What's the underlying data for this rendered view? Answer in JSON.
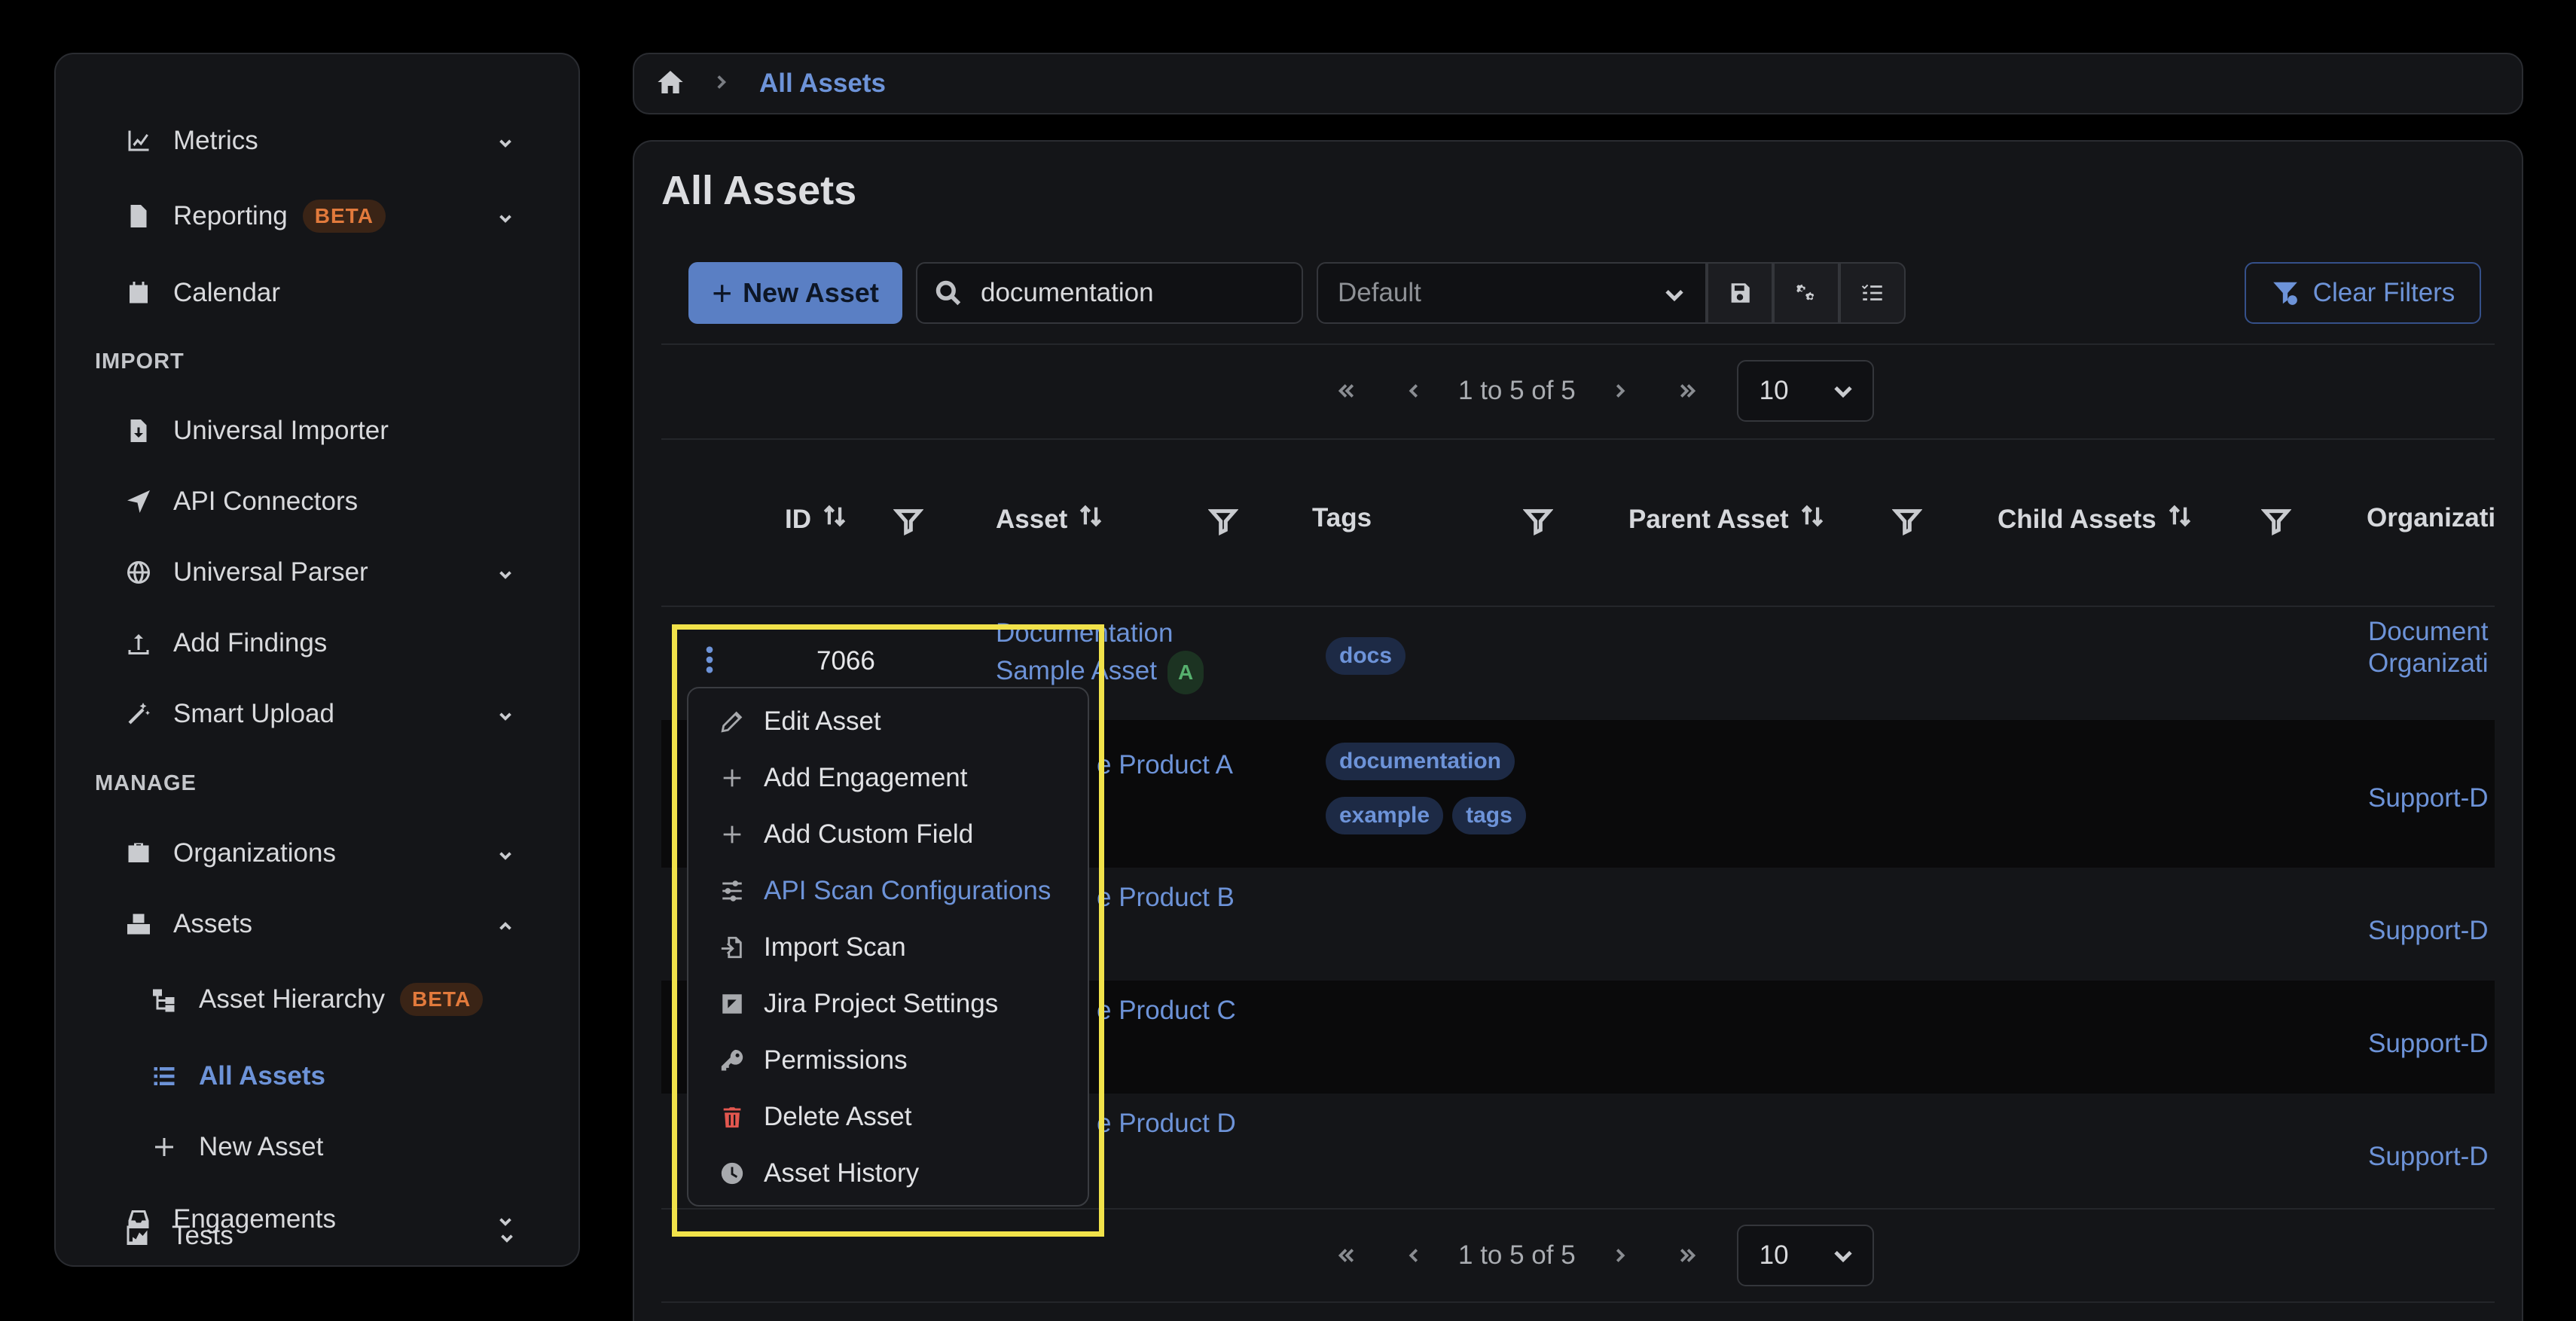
{
  "sidebar": {
    "items_top": [
      {
        "label": "Metrics",
        "icon": "chart-line-icon",
        "expandable": true
      },
      {
        "label": "Reporting",
        "icon": "file-icon",
        "badge": "BETA",
        "expandable": true
      },
      {
        "label": "Calendar",
        "icon": "calendar-icon",
        "expandable": false
      }
    ],
    "section_import": "IMPORT",
    "items_import": [
      {
        "label": "Universal Importer",
        "icon": "file-import-icon",
        "expandable": false
      },
      {
        "label": "API Connectors",
        "icon": "paper-plane-icon",
        "expandable": false
      },
      {
        "label": "Universal Parser",
        "icon": "globe-icon",
        "expandable": true
      },
      {
        "label": "Add Findings",
        "icon": "upload-icon",
        "expandable": false
      },
      {
        "label": "Smart Upload",
        "icon": "magic-wand-icon",
        "expandable": true
      }
    ],
    "section_manage": "MANAGE",
    "items_manage": [
      {
        "label": "Organizations",
        "icon": "briefcase-icon",
        "expandable": true
      },
      {
        "label": "Assets",
        "icon": "boxes-icon",
        "expandable": true,
        "expanded": true
      },
      {
        "label": "Asset Hierarchy",
        "icon": "hierarchy-icon",
        "badge": "BETA",
        "sub": true
      },
      {
        "label": "All Assets",
        "icon": "list-icon",
        "sub": true,
        "active": true
      },
      {
        "label": "New Asset",
        "icon": "plus-icon",
        "sub": true
      },
      {
        "label": "Engagements",
        "icon": "inbox-icon",
        "expandable": true
      },
      {
        "label": "Tests",
        "icon": "tests-icon",
        "expandable": true
      }
    ]
  },
  "breadcrumb": {
    "home_icon": "home-icon",
    "current": "All Assets"
  },
  "page": {
    "title": "All Assets"
  },
  "toolbar": {
    "new_asset_label": "New Asset",
    "search_value": "documentation",
    "view_select_value": "Default",
    "clear_filters_label": "Clear Filters"
  },
  "pagination": {
    "info": "1 to 5 of 5",
    "page_size": "10"
  },
  "table": {
    "columns": [
      "ID",
      "Asset",
      "Tags",
      "Parent Asset",
      "Child Assets",
      "Organizati"
    ],
    "rows": [
      {
        "id": "7066",
        "asset_line1": "Documentation",
        "asset_line2": "Sample Asset",
        "grade": "A",
        "tags": [
          "docs"
        ],
        "org_line1": "Document",
        "org_line2": "Organizati"
      },
      {
        "asset": "e Product A",
        "tags": [
          "documentation",
          "example",
          "tags"
        ],
        "org": "Support-D"
      },
      {
        "asset": "e Product B",
        "tags": [],
        "org": "Support-D"
      },
      {
        "asset": "e Product C",
        "tags": [],
        "org": "Support-D"
      },
      {
        "asset": "e Product D",
        "tags": [],
        "org": "Support-D"
      }
    ]
  },
  "context_menu": {
    "items": [
      {
        "label": "Edit Asset",
        "icon": "pencil-icon"
      },
      {
        "label": "Add Engagement",
        "icon": "plus-icon"
      },
      {
        "label": "Add Custom Field",
        "icon": "plus-icon"
      },
      {
        "label": "API Scan Configurations",
        "icon": "sliders-icon",
        "highlighted": true
      },
      {
        "label": "Import Scan",
        "icon": "file-import-icon"
      },
      {
        "label": "Jira Project Settings",
        "icon": "jira-icon"
      },
      {
        "label": "Permissions",
        "icon": "key-icon"
      },
      {
        "label": "Delete Asset",
        "icon": "trash-icon",
        "danger": true
      },
      {
        "label": "Asset History",
        "icon": "clock-icon"
      }
    ]
  },
  "colors": {
    "accent": "#6d93d8",
    "beta_badge": "#e27a3c",
    "highlight_box": "#f1e24a",
    "danger": "#e2574f"
  }
}
